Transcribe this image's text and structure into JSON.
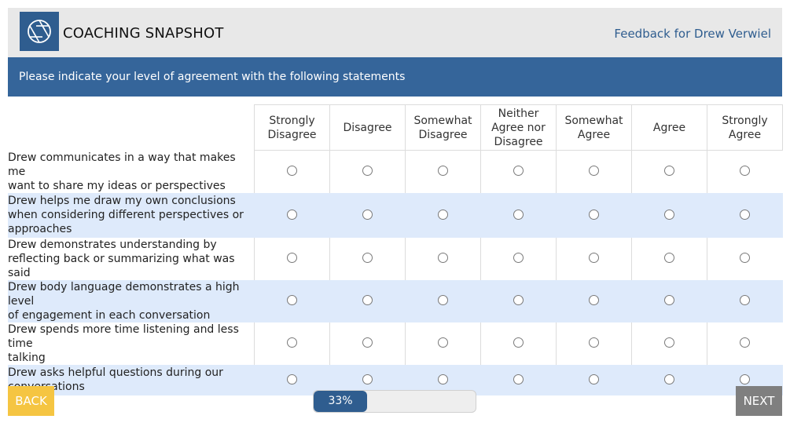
{
  "header": {
    "app_title": "COACHING SNAPSHOT",
    "feedback_for": "Feedback for Drew Verwiel",
    "logo_icon": "aperture-icon",
    "brand_color": "#2f5d8f"
  },
  "banner": {
    "text": "Please indicate your level of agreement with the following statements"
  },
  "scale": {
    "options": [
      [
        "Strongly",
        "Disagree"
      ],
      [
        "Disagree"
      ],
      [
        "Somewhat",
        "Disagree"
      ],
      [
        "Neither",
        "Agree nor",
        "Disagree"
      ],
      [
        "Somewhat",
        "Agree"
      ],
      [
        "Agree"
      ],
      [
        "Strongly",
        "Agree"
      ]
    ]
  },
  "statements": [
    [
      "Drew communicates in a way that makes me",
      "want to share my ideas or perspectives"
    ],
    [
      "Drew helps me draw my own conclusions",
      "when considering different perspectives or",
      "approaches"
    ],
    [
      "Drew demonstrates understanding by",
      "reflecting back or summarizing what was said"
    ],
    [
      "Drew body language demonstrates a high level",
      "of engagement in each conversation"
    ],
    [
      "Drew spends more time listening and less time",
      "talking"
    ],
    [
      "Drew asks helpful questions during our",
      "conversations"
    ]
  ],
  "navigation": {
    "back_label": "BACK",
    "next_label": "NEXT",
    "back_color": "#f5c542",
    "next_color": "#7f7f7f"
  },
  "progress": {
    "label": "33%",
    "value": 0.33
  }
}
